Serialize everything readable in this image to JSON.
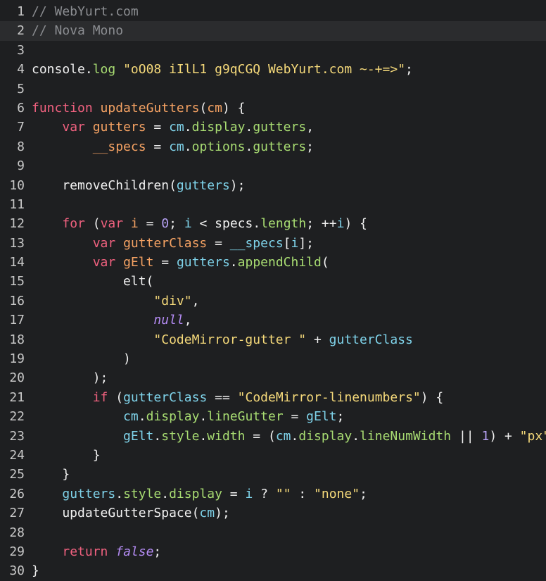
{
  "colors": {
    "background": "#1e1f21",
    "active_line": "#2b2c2e",
    "gutter_text": "#c8c8c8",
    "comment": "#8b8d91",
    "plain": "#f1f1f1",
    "keyword": "#f0617f",
    "string": "#f5d97a",
    "def": "#f5a263",
    "variable": "#a8dc72",
    "property": "#7fd3ea",
    "number": "#b7a2f5",
    "atom": "#b58cf5"
  },
  "editor": {
    "active_line": 2,
    "lines": [
      {
        "n": "1",
        "tokens": [
          [
            "comment",
            "// WebYurt.com"
          ]
        ]
      },
      {
        "n": "2",
        "tokens": [
          [
            "comment",
            "// Nova Mono"
          ]
        ]
      },
      {
        "n": "3",
        "tokens": []
      },
      {
        "n": "4",
        "tokens": [
          [
            "plain",
            "console"
          ],
          [
            "plain",
            "."
          ],
          [
            "variable",
            "log"
          ],
          [
            "plain",
            " "
          ],
          [
            "string",
            "\"oO08 iIlL1 g9qCGQ WebYurt.com ~-+=>\""
          ],
          [
            "plain",
            ";"
          ]
        ]
      },
      {
        "n": "5",
        "tokens": []
      },
      {
        "n": "6",
        "tokens": [
          [
            "keyword",
            "function"
          ],
          [
            "plain",
            " "
          ],
          [
            "def",
            "updateGutters"
          ],
          [
            "plain",
            "("
          ],
          [
            "def",
            "cm"
          ],
          [
            "plain",
            ") {"
          ]
        ]
      },
      {
        "n": "7",
        "tokens": [
          [
            "plain",
            "    "
          ],
          [
            "keyword",
            "var"
          ],
          [
            "plain",
            " "
          ],
          [
            "def",
            "gutters"
          ],
          [
            "plain",
            " = "
          ],
          [
            "property",
            "cm"
          ],
          [
            "plain",
            "."
          ],
          [
            "variable",
            "display"
          ],
          [
            "plain",
            "."
          ],
          [
            "variable",
            "gutters"
          ],
          [
            "plain",
            ","
          ]
        ]
      },
      {
        "n": "8",
        "tokens": [
          [
            "plain",
            "        "
          ],
          [
            "def",
            "__specs"
          ],
          [
            "plain",
            " = "
          ],
          [
            "property",
            "cm"
          ],
          [
            "plain",
            "."
          ],
          [
            "variable",
            "options"
          ],
          [
            "plain",
            "."
          ],
          [
            "variable",
            "gutters"
          ],
          [
            "plain",
            ";"
          ]
        ]
      },
      {
        "n": "9",
        "tokens": []
      },
      {
        "n": "10",
        "tokens": [
          [
            "plain",
            "    removeChildren("
          ],
          [
            "property",
            "gutters"
          ],
          [
            "plain",
            ");"
          ]
        ]
      },
      {
        "n": "11",
        "tokens": []
      },
      {
        "n": "12",
        "tokens": [
          [
            "plain",
            "    "
          ],
          [
            "keyword",
            "for"
          ],
          [
            "plain",
            " ("
          ],
          [
            "keyword",
            "var"
          ],
          [
            "plain",
            " "
          ],
          [
            "def",
            "i"
          ],
          [
            "plain",
            " = "
          ],
          [
            "number",
            "0"
          ],
          [
            "plain",
            "; "
          ],
          [
            "property",
            "i"
          ],
          [
            "plain",
            " < specs."
          ],
          [
            "variable",
            "length"
          ],
          [
            "plain",
            "; ++"
          ],
          [
            "property",
            "i"
          ],
          [
            "plain",
            ") {"
          ]
        ]
      },
      {
        "n": "13",
        "tokens": [
          [
            "plain",
            "        "
          ],
          [
            "keyword",
            "var"
          ],
          [
            "plain",
            " "
          ],
          [
            "def",
            "gutterClass"
          ],
          [
            "plain",
            " = "
          ],
          [
            "property",
            "__specs"
          ],
          [
            "plain",
            "["
          ],
          [
            "property",
            "i"
          ],
          [
            "plain",
            "];"
          ]
        ]
      },
      {
        "n": "14",
        "tokens": [
          [
            "plain",
            "        "
          ],
          [
            "keyword",
            "var"
          ],
          [
            "plain",
            " "
          ],
          [
            "def",
            "gElt"
          ],
          [
            "plain",
            " = "
          ],
          [
            "property",
            "gutters"
          ],
          [
            "plain",
            "."
          ],
          [
            "variable",
            "appendChild"
          ],
          [
            "plain",
            "("
          ]
        ]
      },
      {
        "n": "15",
        "tokens": [
          [
            "plain",
            "            elt("
          ]
        ]
      },
      {
        "n": "16",
        "tokens": [
          [
            "plain",
            "                "
          ],
          [
            "string",
            "\"div\""
          ],
          [
            "plain",
            ","
          ]
        ]
      },
      {
        "n": "17",
        "tokens": [
          [
            "plain",
            "                "
          ],
          [
            "atom",
            "null"
          ],
          [
            "plain",
            ","
          ]
        ]
      },
      {
        "n": "18",
        "tokens": [
          [
            "plain",
            "                "
          ],
          [
            "string",
            "\"CodeMirror-gutter \""
          ],
          [
            "plain",
            " + "
          ],
          [
            "property",
            "gutterClass"
          ]
        ]
      },
      {
        "n": "19",
        "tokens": [
          [
            "plain",
            "            )"
          ]
        ]
      },
      {
        "n": "20",
        "tokens": [
          [
            "plain",
            "        );"
          ]
        ]
      },
      {
        "n": "21",
        "tokens": [
          [
            "plain",
            "        "
          ],
          [
            "keyword",
            "if"
          ],
          [
            "plain",
            " ("
          ],
          [
            "property",
            "gutterClass"
          ],
          [
            "plain",
            " == "
          ],
          [
            "string",
            "\"CodeMirror-linenumbers\""
          ],
          [
            "plain",
            ") {"
          ]
        ]
      },
      {
        "n": "22",
        "tokens": [
          [
            "plain",
            "            "
          ],
          [
            "property",
            "cm"
          ],
          [
            "plain",
            "."
          ],
          [
            "variable",
            "display"
          ],
          [
            "plain",
            "."
          ],
          [
            "variable",
            "lineGutter"
          ],
          [
            "plain",
            " = "
          ],
          [
            "property",
            "gElt"
          ],
          [
            "plain",
            ";"
          ]
        ]
      },
      {
        "n": "23",
        "tokens": [
          [
            "plain",
            "            "
          ],
          [
            "property",
            "gElt"
          ],
          [
            "plain",
            "."
          ],
          [
            "variable",
            "style"
          ],
          [
            "plain",
            "."
          ],
          [
            "variable",
            "width"
          ],
          [
            "plain",
            " = ("
          ],
          [
            "property",
            "cm"
          ],
          [
            "plain",
            "."
          ],
          [
            "variable",
            "display"
          ],
          [
            "plain",
            "."
          ],
          [
            "variable",
            "lineNumWidth"
          ],
          [
            "plain",
            " || "
          ],
          [
            "number",
            "1"
          ],
          [
            "plain",
            ") + "
          ],
          [
            "string",
            "\"px\""
          ],
          [
            "plain",
            ";"
          ]
        ]
      },
      {
        "n": "24",
        "tokens": [
          [
            "plain",
            "        }"
          ]
        ]
      },
      {
        "n": "25",
        "tokens": [
          [
            "plain",
            "    }"
          ]
        ]
      },
      {
        "n": "26",
        "tokens": [
          [
            "plain",
            "    "
          ],
          [
            "property",
            "gutters"
          ],
          [
            "plain",
            "."
          ],
          [
            "variable",
            "style"
          ],
          [
            "plain",
            "."
          ],
          [
            "variable",
            "display"
          ],
          [
            "plain",
            " = "
          ],
          [
            "property",
            "i"
          ],
          [
            "plain",
            " ? "
          ],
          [
            "string",
            "\"\""
          ],
          [
            "plain",
            " : "
          ],
          [
            "string",
            "\"none\""
          ],
          [
            "plain",
            ";"
          ]
        ]
      },
      {
        "n": "27",
        "tokens": [
          [
            "plain",
            "    updateGutterSpace("
          ],
          [
            "property",
            "cm"
          ],
          [
            "plain",
            ");"
          ]
        ]
      },
      {
        "n": "28",
        "tokens": []
      },
      {
        "n": "29",
        "tokens": [
          [
            "plain",
            "    "
          ],
          [
            "keyword",
            "return"
          ],
          [
            "plain",
            " "
          ],
          [
            "atom",
            "false"
          ],
          [
            "plain",
            ";"
          ]
        ]
      },
      {
        "n": "30",
        "tokens": [
          [
            "plain",
            "}"
          ]
        ]
      }
    ]
  }
}
